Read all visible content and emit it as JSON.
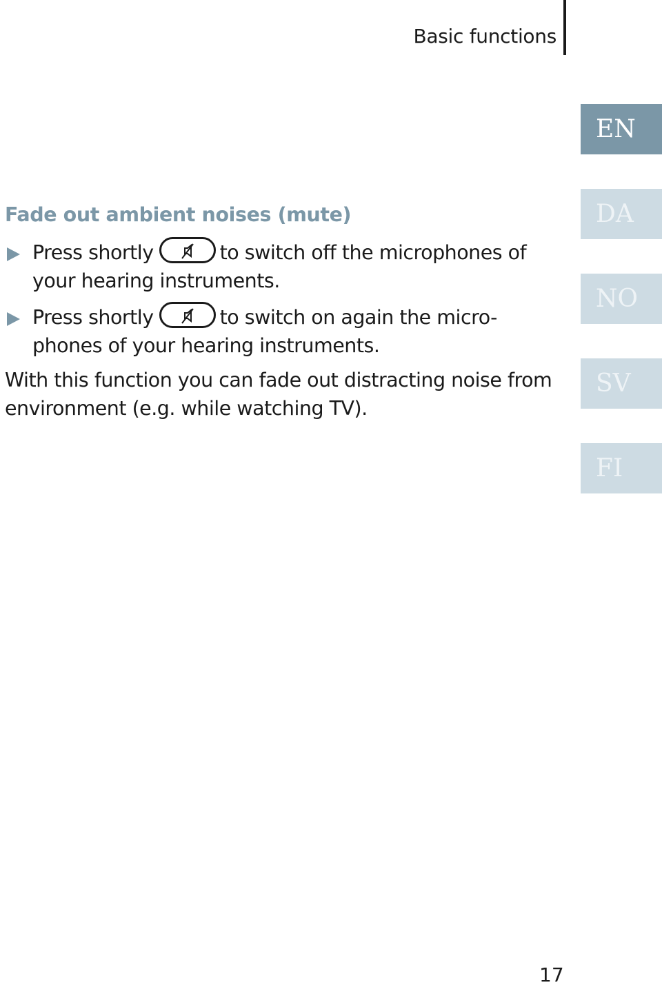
{
  "header": {
    "section_title": "Basic functions"
  },
  "language_tabs": [
    {
      "code": "EN",
      "active": true
    },
    {
      "code": "DA",
      "active": false
    },
    {
      "code": "NO",
      "active": false
    },
    {
      "code": "SV",
      "active": false
    },
    {
      "code": "FI",
      "active": false
    }
  ],
  "content": {
    "heading": "Fade out ambient noises (mute)",
    "steps": [
      {
        "prefix": "Press shortly",
        "button_icon": "mute-speaker-icon",
        "suffix": "to switch off the microphones of your hearing instruments."
      },
      {
        "prefix": "Press shortly",
        "button_icon": "mute-speaker-icon",
        "suffix": "to switch on again the micro- phones of your hearing instruments."
      }
    ],
    "note": "With this function you can fade out distracting noise from environment (e.g. while watching TV)."
  },
  "footer": {
    "page_number": "17"
  },
  "colors": {
    "accent": "#7b97a7",
    "tab_inactive": "#cddbe3",
    "text": "#1a1a1a"
  }
}
